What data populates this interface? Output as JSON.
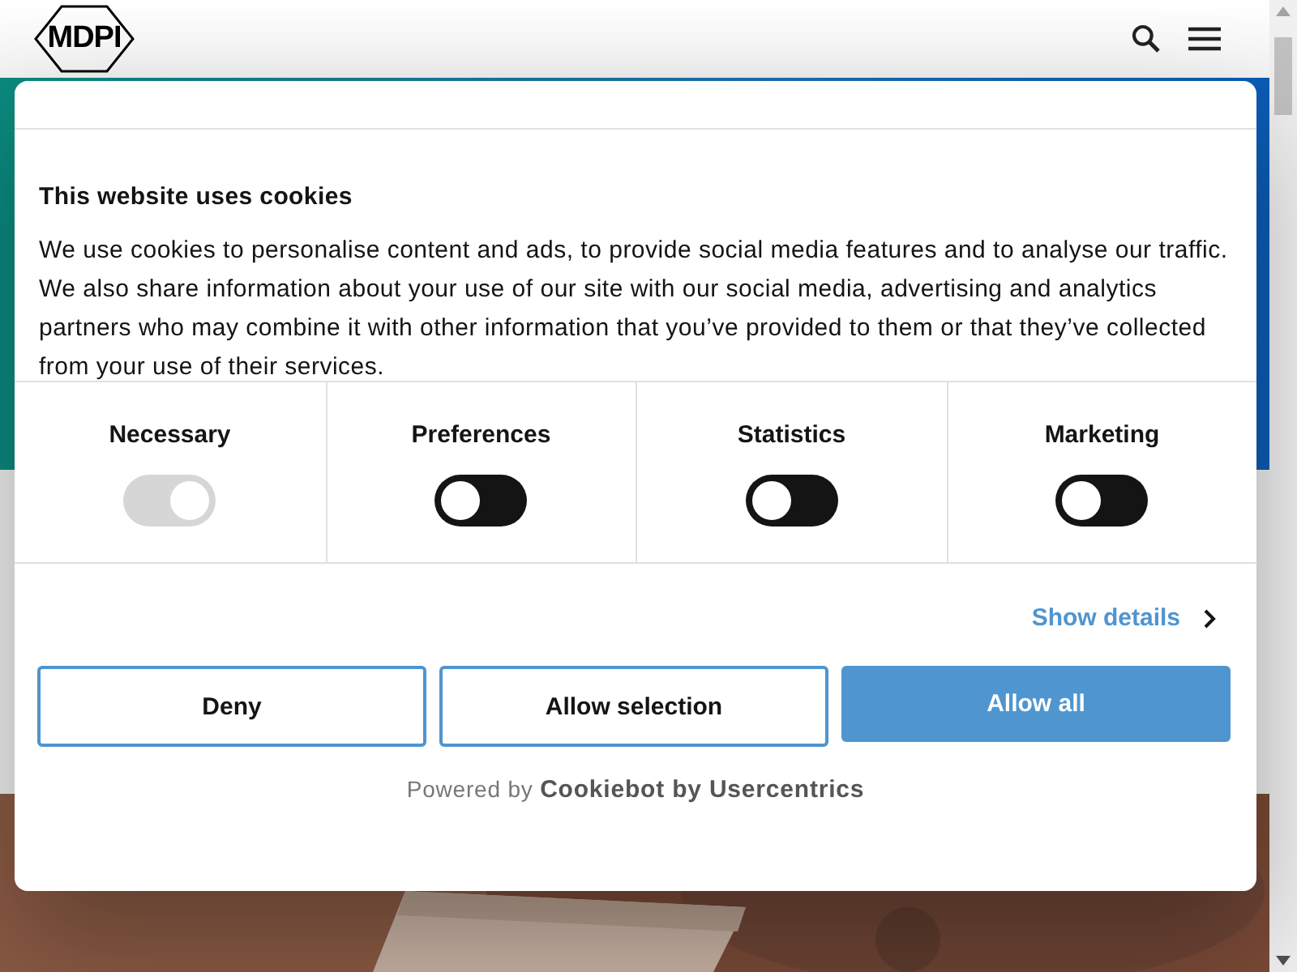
{
  "header": {
    "logo": "MDPI"
  },
  "dialog": {
    "title": "This website uses cookies",
    "body": "We use cookies to personalise content and ads, to provide social media features and to analyse our traffic. We also share information about your use of our site with our social media, advertising and analytics partners who may combine it with other information that you’ve provided to them or that they’ve collected from your use of their services.",
    "categories": [
      {
        "label": "Necessary",
        "checked": true,
        "disabled": true
      },
      {
        "label": "Preferences",
        "checked": false,
        "disabled": false
      },
      {
        "label": "Statistics",
        "checked": false,
        "disabled": false
      },
      {
        "label": "Marketing",
        "checked": false,
        "disabled": false
      }
    ],
    "details_link": "Show details",
    "buttons": [
      {
        "label": "Deny",
        "kind": "outline"
      },
      {
        "label": "Allow selection",
        "kind": "outline"
      },
      {
        "label": "Allow all",
        "kind": "primary"
      }
    ],
    "powered_by": "Powered by **Cookiebot by Usercentrics**"
  }
}
